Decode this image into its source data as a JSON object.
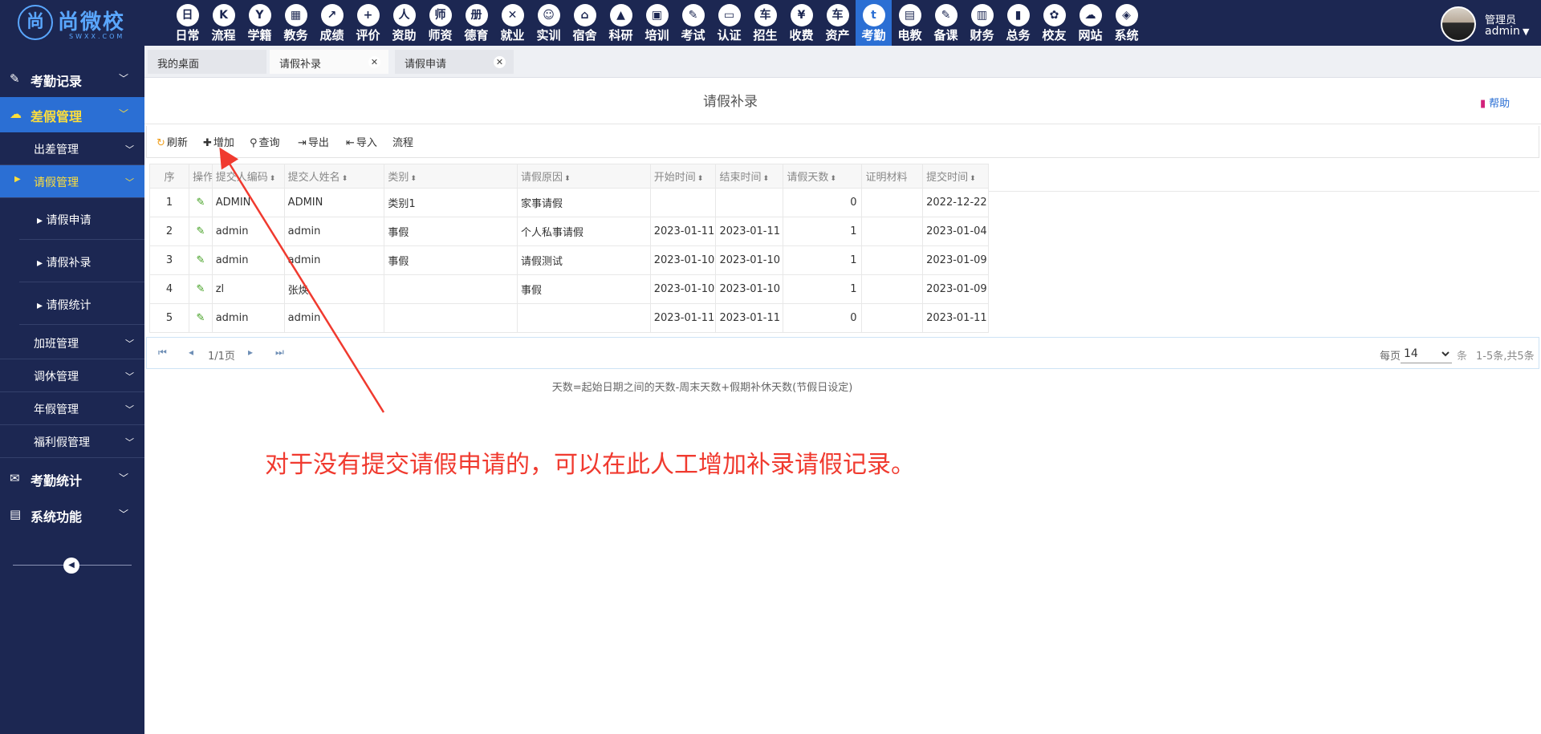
{
  "brand": {
    "seal": "尚",
    "name": "尚微校",
    "sub": "SWXX.COM"
  },
  "nav": [
    {
      "label": "日常",
      "icon": "日"
    },
    {
      "label": "流程",
      "icon": "K"
    },
    {
      "label": "学籍",
      "icon": "Y"
    },
    {
      "label": "教务",
      "icon": "▦"
    },
    {
      "label": "成绩",
      "icon": "↗"
    },
    {
      "label": "评价",
      "icon": "+"
    },
    {
      "label": "资助",
      "icon": "人"
    },
    {
      "label": "师资",
      "icon": "师"
    },
    {
      "label": "德育",
      "icon": "册"
    },
    {
      "label": "就业",
      "icon": "✕"
    },
    {
      "label": "实训",
      "icon": "☺"
    },
    {
      "label": "宿舍",
      "icon": "⌂"
    },
    {
      "label": "科研",
      "icon": "▲"
    },
    {
      "label": "培训",
      "icon": "▣"
    },
    {
      "label": "考试",
      "icon": "✎"
    },
    {
      "label": "认证",
      "icon": "▭"
    },
    {
      "label": "招生",
      "icon": "车"
    },
    {
      "label": "收费",
      "icon": "¥"
    },
    {
      "label": "资产",
      "icon": "车"
    },
    {
      "label": "考勤",
      "icon": "t"
    },
    {
      "label": "电教",
      "icon": "▤"
    },
    {
      "label": "备课",
      "icon": "✎"
    },
    {
      "label": "财务",
      "icon": "▥"
    },
    {
      "label": "总务",
      "icon": "▮"
    },
    {
      "label": "校友",
      "icon": "✿"
    },
    {
      "label": "网站",
      "icon": "☁"
    },
    {
      "label": "系统",
      "icon": "◈"
    }
  ],
  "user": {
    "role": "管理员",
    "name": "admin"
  },
  "sidebar": {
    "groups": [
      {
        "label": "考勤记录",
        "icon": "✎"
      },
      {
        "label": "差假管理",
        "icon": "☁"
      },
      {
        "label": "考勤统计",
        "icon": "✉"
      },
      {
        "label": "系统功能",
        "icon": "▤"
      }
    ],
    "subs": [
      "出差管理",
      "请假管理",
      "加班管理",
      "调休管理",
      "年假管理",
      "福利假管理"
    ],
    "leaves": [
      "请假申请",
      "请假补录",
      "请假统计"
    ]
  },
  "tabs": [
    "我的桌面",
    "请假补录",
    "请假申请"
  ],
  "page": {
    "title": "请假补录",
    "help": "帮助"
  },
  "toolbar": [
    "刷新",
    "增加",
    "查询",
    "导出",
    "导入",
    "流程"
  ],
  "table": {
    "columns": [
      "序",
      "操作",
      "提交人编码",
      "提交人姓名",
      "类别",
      "请假原因",
      "开始时间",
      "结束时间",
      "请假天数",
      "证明材料",
      "提交时间"
    ],
    "rows": [
      [
        "1",
        "ADMIN",
        "ADMIN",
        "类别1",
        "家事请假",
        "",
        "",
        "0",
        "",
        "2022-12-22"
      ],
      [
        "2",
        "admin",
        "admin",
        "事假",
        "个人私事请假",
        "2023-01-11",
        "2023-01-11",
        "1",
        "",
        "2023-01-04"
      ],
      [
        "3",
        "admin",
        "admin",
        "事假",
        "请假测试",
        "2023-01-10",
        "2023-01-10",
        "1",
        "",
        "2023-01-09"
      ],
      [
        "4",
        "zl",
        "张焕",
        "",
        "事假",
        "2023-01-10",
        "2023-01-10",
        "1",
        "",
        "2023-01-09"
      ],
      [
        "5",
        "admin",
        "admin",
        "",
        "",
        "2023-01-11",
        "2023-01-11",
        "0",
        "",
        "2023-01-11"
      ]
    ]
  },
  "pager": {
    "pages": "1/1页",
    "per_label": "每页",
    "per_value": "14",
    "unit": "条",
    "total": "1-5条,共5条"
  },
  "footnote": "天数=起始日期之间的天数-周末天数+假期补休天数(节假日设定)",
  "annotation": "对于没有提交请假申请的，可以在此人工增加补录请假记录。",
  "colors": {
    "navy": "#1c2752",
    "accent": "#2b6fd4",
    "highlight": "#ffdf3a",
    "annotation": "#f03a2f"
  }
}
